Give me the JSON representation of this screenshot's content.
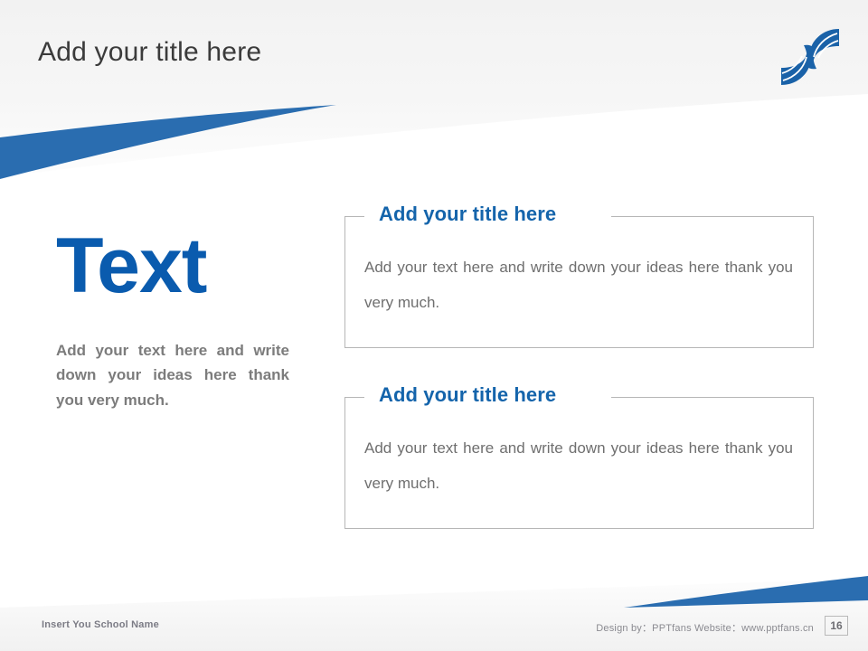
{
  "slide": {
    "title": "Add your title here",
    "page_number": "16"
  },
  "logo": {
    "name": "swirl-s-logo",
    "color": "#1a62a8"
  },
  "left_panel": {
    "headline": "Text",
    "body": "Add your text here and write down your ideas here thank you very much."
  },
  "cards": [
    {
      "title": "Add your title here",
      "body": "Add your text here and write down your ideas here thank you very much."
    },
    {
      "title": "Add your title here",
      "body": "Add your text here and write down your ideas here thank you very much."
    }
  ],
  "footer": {
    "school_name": "Insert You School Name",
    "credit": "Design by：PPTfans  Website：www.pptfans.cn"
  },
  "colors": {
    "accent_blue": "#2a6db0",
    "headline_blue": "#0a5bae",
    "card_title_blue": "#1464ab",
    "body_gray": "#6f6f6f",
    "title_gray": "#3b3b3b",
    "header_gradient_top": "#f4f4f4",
    "header_gradient_bottom": "#fcfcfc"
  }
}
